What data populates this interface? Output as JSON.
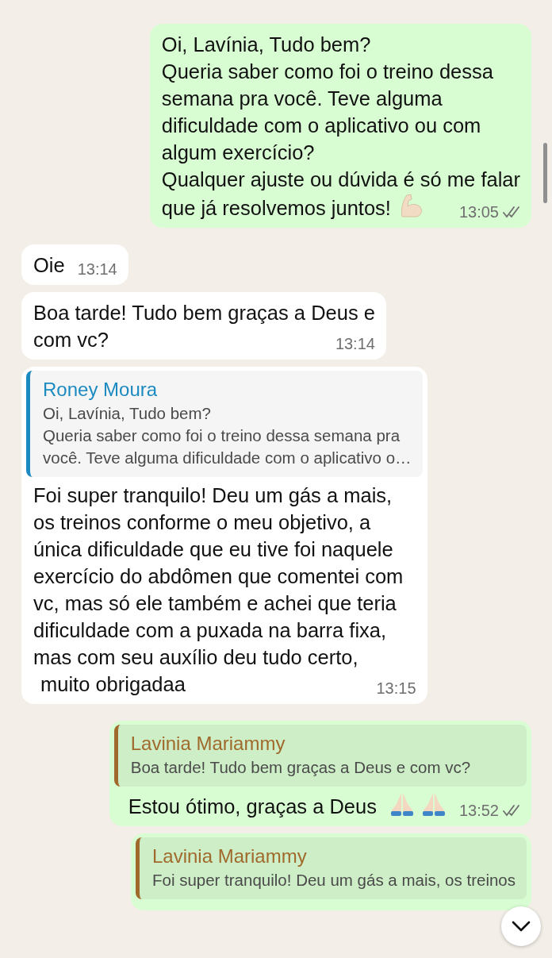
{
  "messages": [
    {
      "outgoing": true,
      "lines": [
        "Oi, Lavínia, Tudo bem?",
        "Queria saber como foi o treino dessa",
        "semana pra você. Teve alguma",
        "dificuldade com o aplicativo ou com",
        "algum exercício?",
        "Qualquer ajuste ou dúvida é só me falar",
        "que já resolvemos juntos!"
      ],
      "emojis": [
        {
          "kind": "flexed-arm"
        }
      ],
      "time": "13:05",
      "delivered": true
    },
    {
      "outgoing": false,
      "lines": [
        "Oie"
      ],
      "time": "13:14"
    },
    {
      "outgoing": false,
      "lines": [
        "Boa tarde! Tudo bem graças a Deus e",
        "com vc?"
      ],
      "time": "13:14"
    },
    {
      "outgoing": false,
      "quote": {
        "author": "Roney Moura",
        "color": "#1b8ac0",
        "lines": [
          "Oi, Lavínia, Tudo bem?",
          "Queria saber como foi o treino dessa semana pra",
          "você. Teve alguma dificuldade com o aplicativo o…"
        ]
      },
      "lines": [
        "Foi super tranquilo! Deu um gás a mais,",
        "os treinos conforme o meu objetivo, a",
        "única dificuldade que eu tive foi naquele",
        "exercício do abdômen que comentei com",
        "vc, mas só ele também e achei que teria",
        "dificuldade com a puxada na barra fixa,",
        "mas com seu auxílio deu tudo certo,",
        "muito obrigadaa"
      ],
      "time": "13:15"
    },
    {
      "outgoing": true,
      "quote": {
        "author": "Lavinia Mariammy",
        "color": "#a06a2c",
        "lines": [
          "Boa tarde! Tudo bem graças a Deus e com vc?"
        ]
      },
      "lines": [
        "Estou ótimo, graças a Deus"
      ],
      "emojis": [
        {
          "kind": "praying-hands"
        },
        {
          "kind": "praying-hands"
        }
      ],
      "time": "13:52",
      "delivered": true
    },
    {
      "outgoing": true,
      "quote": {
        "author": "Lavinia Mariammy",
        "color": "#a06a2c",
        "lines": [
          "Foi super tranquilo! Deu um gás a mais, os treinos"
        ]
      }
    }
  ]
}
